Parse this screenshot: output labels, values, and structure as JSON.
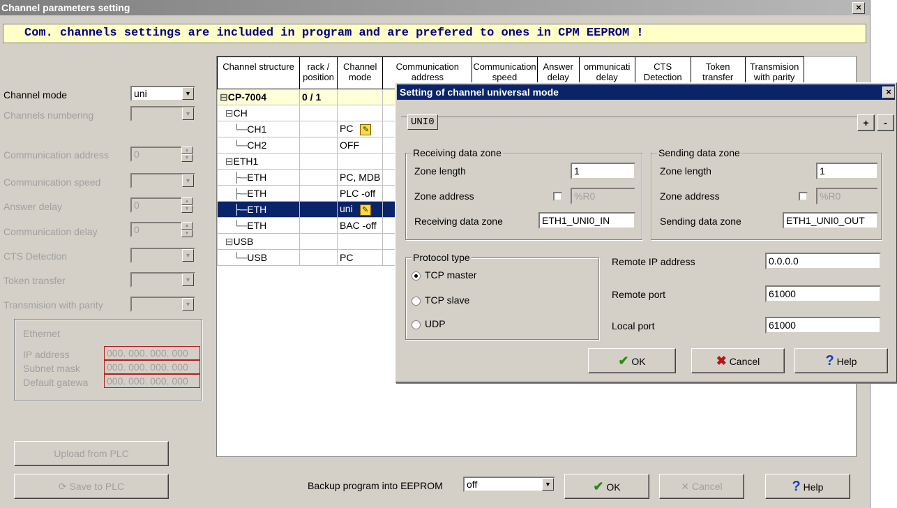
{
  "window": {
    "title": "Channel parameters setting",
    "close": "×"
  },
  "banner": "Com. channels settings are included in program and are prefered to ones in CPM EEPROM !",
  "left": {
    "channel_mode": {
      "label": "Channel mode",
      "value": "uni"
    },
    "channels_numbering": {
      "label": "Channels numbering",
      "value": ""
    },
    "comm_address": {
      "label": "Communication address",
      "value": "0"
    },
    "comm_speed": {
      "label": "Communication speed",
      "value": ""
    },
    "answer_delay": {
      "label": "Answer delay",
      "value": "0"
    },
    "comm_delay": {
      "label": "Communication delay",
      "value": "0"
    },
    "cts": {
      "label": "CTS Detection",
      "value": ""
    },
    "token": {
      "label": "Token transfer",
      "value": ""
    },
    "parity": {
      "label": "Transmision with parity",
      "value": ""
    },
    "ethernet": {
      "title": "Ethernet",
      "ip_label": "IP address",
      "ip": "000. 000. 000. 000",
      "mask_label": "Subnet mask",
      "mask": "000. 000. 000. 000",
      "gw_label": "Default gatewa",
      "gw": "000. 000. 000. 000"
    },
    "upload": "Upload from PLC",
    "save": "Save to PLC"
  },
  "grid": {
    "headers": [
      "Channel structure",
      "rack / position",
      "Channel mode",
      "Communication address",
      "Communication speed",
      "Answer delay",
      "ommunicati delay",
      "CTS Detection",
      "Token transfer",
      "Transmision with parity"
    ],
    "rows": [
      {
        "indent": "⊟",
        "name": "CP-7004",
        "pos": "0 / 1",
        "mode": ""
      },
      {
        "indent": "  ⊟",
        "name": "CH",
        "pos": "",
        "mode": ""
      },
      {
        "indent": "     └─",
        "name": "CH1",
        "pos": "",
        "mode": "PC"
      },
      {
        "indent": "     └─",
        "name": "CH2",
        "pos": "",
        "mode": "OFF"
      },
      {
        "indent": "  ⊟",
        "name": "ETH1",
        "pos": "",
        "mode": ""
      },
      {
        "indent": "     ├─",
        "name": "ETH",
        "pos": "",
        "mode": "PC, MDB"
      },
      {
        "indent": "     ├─",
        "name": "ETH",
        "pos": "",
        "mode": "PLC -off"
      },
      {
        "indent": "     ├─",
        "name": "ETH",
        "pos": "",
        "mode": "uni"
      },
      {
        "indent": "     └─",
        "name": "ETH",
        "pos": "",
        "mode": "BAC -off"
      },
      {
        "indent": "  ⊟",
        "name": "USB",
        "pos": "",
        "mode": ""
      },
      {
        "indent": "     └─",
        "name": "USB",
        "pos": "",
        "mode": "PC"
      }
    ]
  },
  "bottom": {
    "backup_label": "Backup program into EEPROM",
    "backup_value": "off",
    "ok": "OK",
    "cancel": "Cancel",
    "help": "Help"
  },
  "dialog": {
    "title": "Setting of channel universal mode",
    "tab": "UNI0",
    "plus": "+",
    "minus": "-",
    "receiving": {
      "title": "Receiving data zone",
      "len_label": "Zone length",
      "len": "1",
      "addr_label": "Zone address",
      "addr": "%R0",
      "zone_label": "Receiving data zone",
      "zone": "ETH1_UNI0_IN"
    },
    "sending": {
      "title": "Sending data zone",
      "len_label": "Zone length",
      "len": "1",
      "addr_label": "Zone address",
      "addr": "%R0",
      "zone_label": "Sending data zone",
      "zone": "ETH1_UNI0_OUT"
    },
    "protocol": {
      "title": "Protocol type",
      "options": [
        "TCP master",
        "TCP slave",
        "UDP"
      ],
      "selected": "TCP master"
    },
    "remote_ip_label": "Remote IP address",
    "remote_ip": "0.0.0.0",
    "remote_port_label": "Remote port",
    "remote_port": "61000",
    "local_port_label": "Local port",
    "local_port": "61000",
    "ok": "OK",
    "cancel": "Cancel",
    "help": "Help"
  }
}
